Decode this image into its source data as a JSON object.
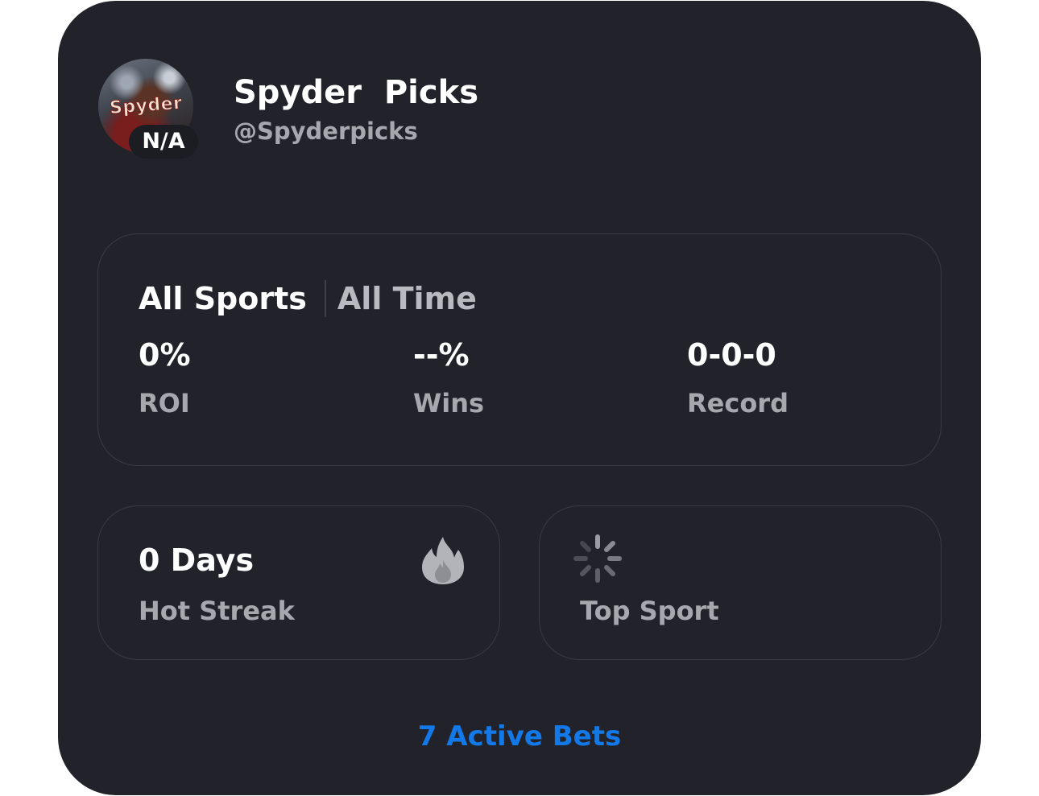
{
  "profile": {
    "avatar_text": "Spyder",
    "badge": "N/A",
    "name": "Spyder  Picks",
    "handle": "@Spyderpicks"
  },
  "filters": {
    "sport": "All Sports",
    "time": "All Time"
  },
  "stats": {
    "roi": {
      "value": "0%",
      "label": "ROI"
    },
    "wins": {
      "value": "--%",
      "label": "Wins"
    },
    "record": {
      "value": "0-0-0",
      "label": "Record"
    }
  },
  "hot_streak": {
    "value": "0 Days",
    "label": "Hot Streak",
    "icon": "fire-icon"
  },
  "top_sport": {
    "label": "Top Sport",
    "icon": "loading-spinner-icon"
  },
  "footer": {
    "active_bets": "7 Active Bets"
  },
  "colors": {
    "card_background": "#22232a",
    "accent": "#1479e8",
    "muted_text": "#a7a8ad",
    "border": "#3a3b42"
  }
}
